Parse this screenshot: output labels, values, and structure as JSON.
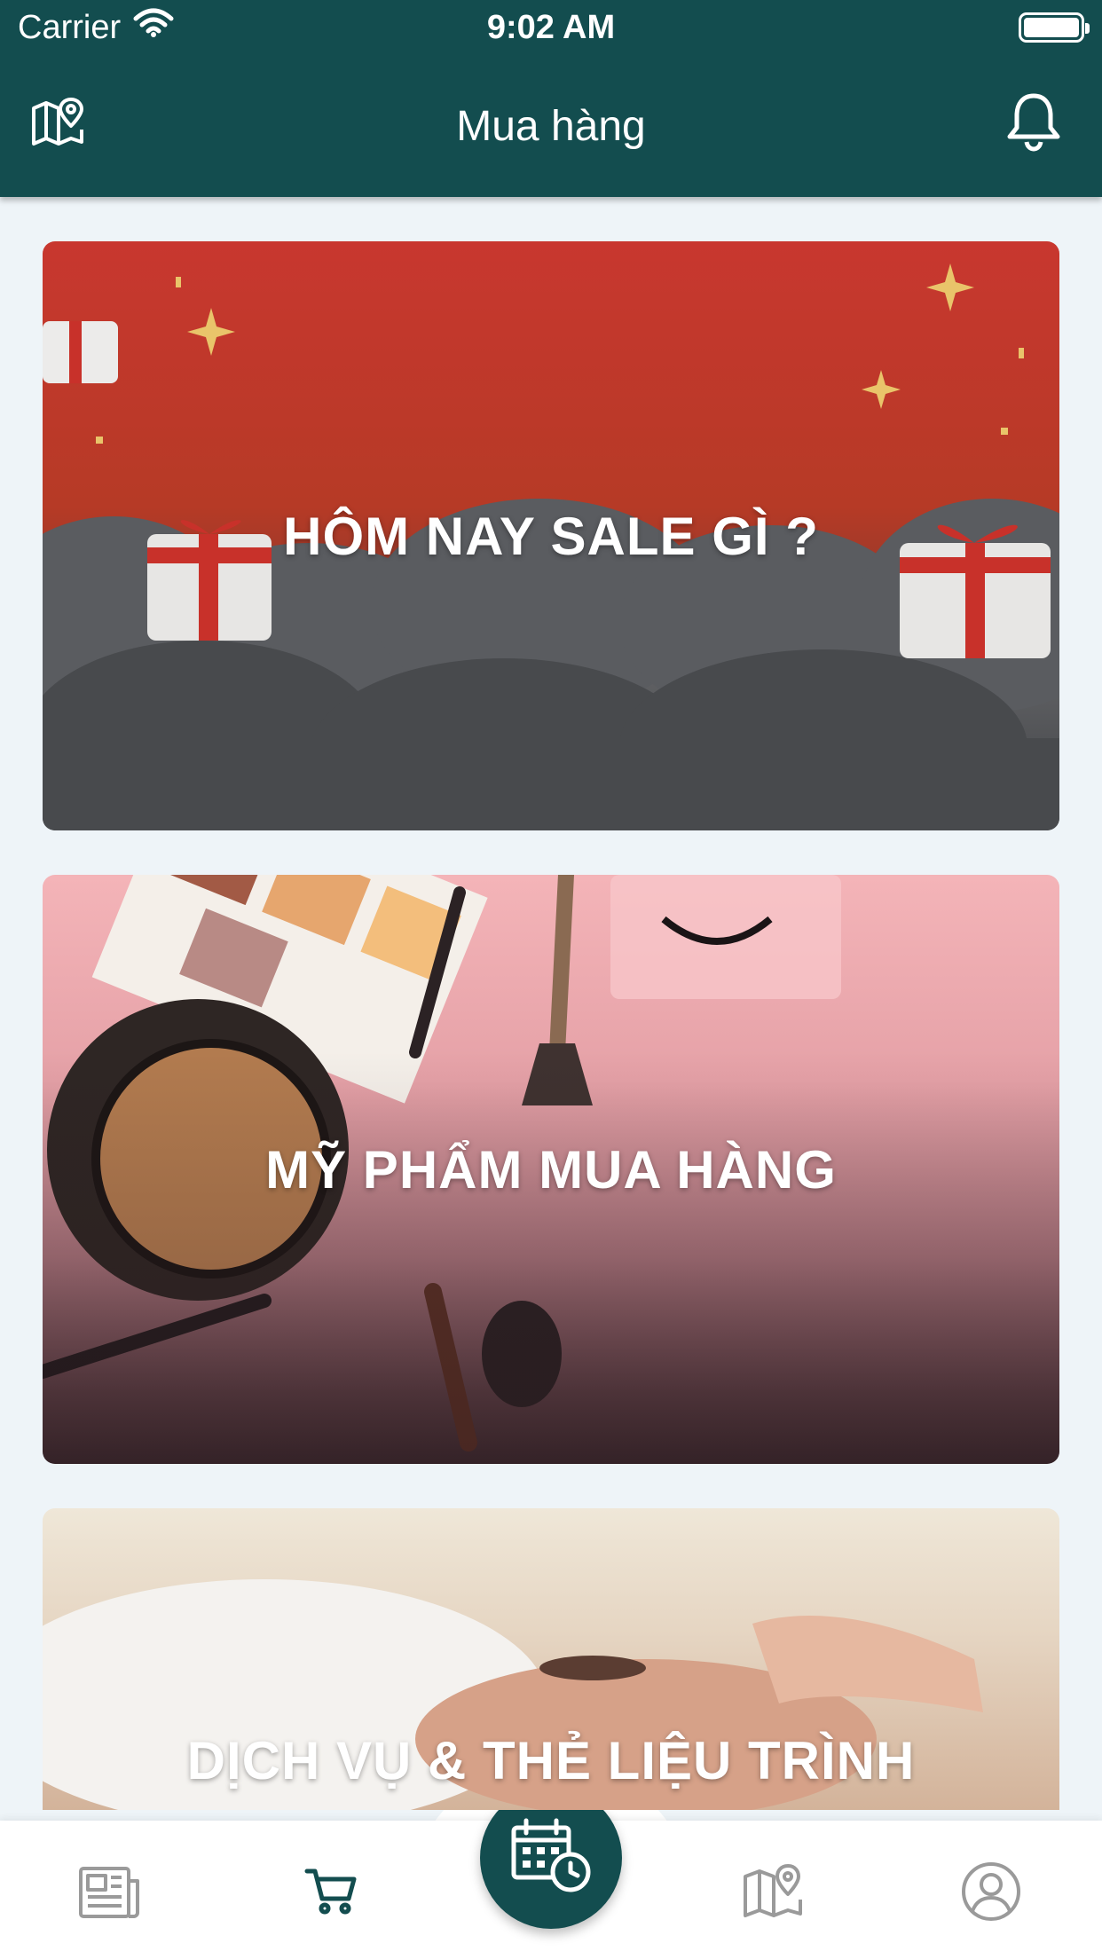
{
  "status_bar": {
    "carrier": "Carrier",
    "time": "9:02 AM"
  },
  "header": {
    "title": "Mua hàng",
    "left_icon": "map-pin-icon",
    "right_icon": "bell-icon"
  },
  "cards": [
    {
      "label": "HÔM NAY SALE GÌ ?",
      "theme": "gift-sale"
    },
    {
      "label": "MỸ PHẨM MUA HÀNG",
      "theme": "cosmetics"
    },
    {
      "label": "DỊCH VỤ & THẺ LIỆU TRÌNH",
      "theme": "spa-service"
    }
  ],
  "tabbar": {
    "items": [
      {
        "icon": "newspaper-icon",
        "active": false
      },
      {
        "icon": "cart-icon",
        "active": true
      },
      {
        "icon": "calendar-clock-icon",
        "active": false
      },
      {
        "icon": "map-icon",
        "active": false
      },
      {
        "icon": "user-circle-icon",
        "active": false
      }
    ]
  },
  "colors": {
    "primary": "#134d4f",
    "background": "#eef4f8",
    "inactive_icon": "#9a9a9a"
  }
}
